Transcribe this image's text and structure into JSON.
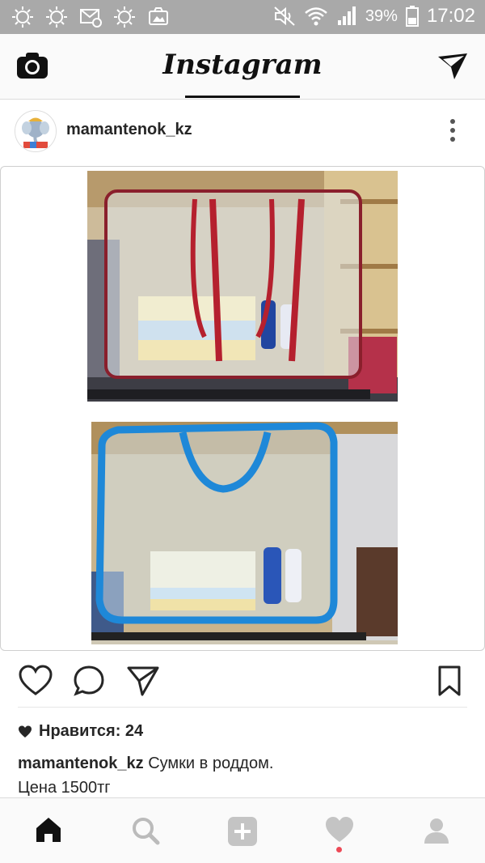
{
  "status_bar": {
    "battery": "39%",
    "time": "17:02",
    "icons": [
      "weather-sun-icon",
      "weather-sun-icon",
      "email-icon",
      "weather-sun-icon",
      "gallery-icon",
      "mute-icon",
      "wifi-icon",
      "signal-icon",
      "battery-icon"
    ]
  },
  "header": {
    "title": "Instagram",
    "left_icon": "camera-icon",
    "right_icon": "direct-message-icon"
  },
  "post": {
    "username": "mamantenok_kz",
    "likes_label": "Нравится: 24",
    "caption_user": "mamantenok_kz",
    "caption_line1": "Сумки в роддом.",
    "caption_line2": "Цена 1500тг"
  },
  "colors": {
    "accent_red": "#ed4956",
    "bag_red_trim": "#9b1c2c",
    "bag_blue": "#1e88d8"
  }
}
